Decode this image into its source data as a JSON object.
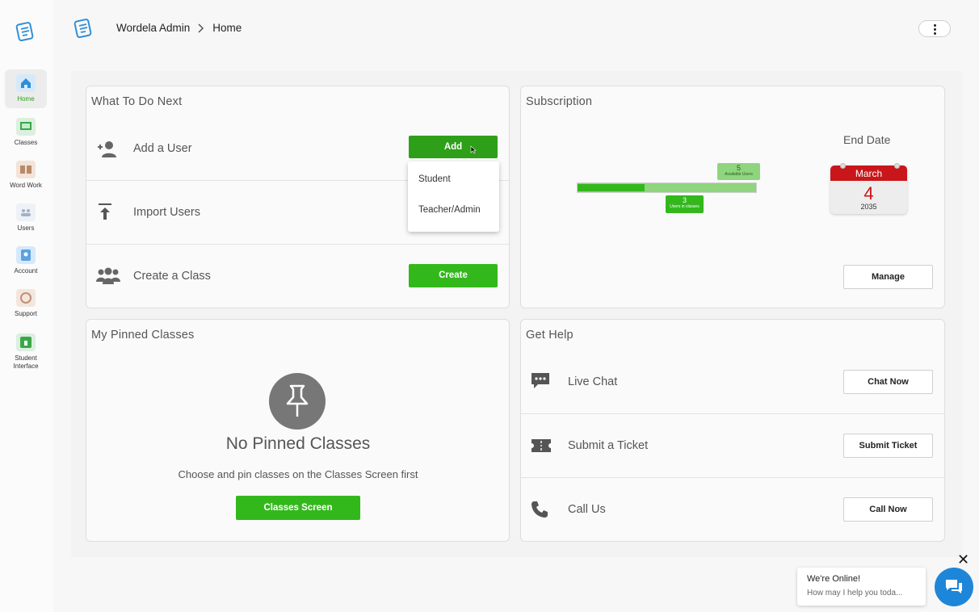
{
  "sidebar": {
    "items": [
      {
        "label": "Home",
        "icon": "home-icon"
      },
      {
        "label": "Classes",
        "icon": "classes-icon"
      },
      {
        "label": "Word Work",
        "icon": "book-icon"
      },
      {
        "label": "Users",
        "icon": "users-icon"
      },
      {
        "label": "Account",
        "icon": "account-icon"
      },
      {
        "label": "Support",
        "icon": "support-icon"
      },
      {
        "label": "Student Interface",
        "icon": "student-interface-icon"
      }
    ]
  },
  "header": {
    "breadcrumb": [
      "Wordela Admin",
      "Home"
    ],
    "separator": ">"
  },
  "todo": {
    "title": "What To Do Next",
    "rows": [
      {
        "label": "Add a User",
        "button": "Add"
      },
      {
        "label": "Import Users"
      },
      {
        "label": "Create a Class",
        "button": "Create"
      }
    ],
    "dropdown": [
      "Student",
      "Teacher/Admin"
    ]
  },
  "subscription": {
    "title": "Subscription",
    "available_users": {
      "value": "5",
      "label": "Available Users"
    },
    "users_in_classes": {
      "value": "3",
      "label": "Users in classes"
    },
    "end_date_label": "End Date",
    "end_date": {
      "month": "March",
      "day": "4",
      "year": "2035"
    },
    "manage_button": "Manage"
  },
  "pinned": {
    "title": "My Pinned Classes",
    "empty_title": "No Pinned Classes",
    "empty_subtitle": "Choose and pin classes on the Classes Screen first",
    "button": "Classes Screen"
  },
  "help": {
    "title": "Get Help",
    "rows": [
      {
        "label": "Live Chat",
        "button": "Chat Now"
      },
      {
        "label": "Submit a Ticket",
        "button": "Submit Ticket"
      },
      {
        "label": "Call Us",
        "button": "Call Now"
      }
    ]
  },
  "chat_widget": {
    "close": "✕",
    "line1": "We're Online!",
    "line2": "How may I help you toda..."
  },
  "colors": {
    "accent": "#33b81c",
    "chat": "#1e86d9",
    "calendar": "#c9161a"
  }
}
